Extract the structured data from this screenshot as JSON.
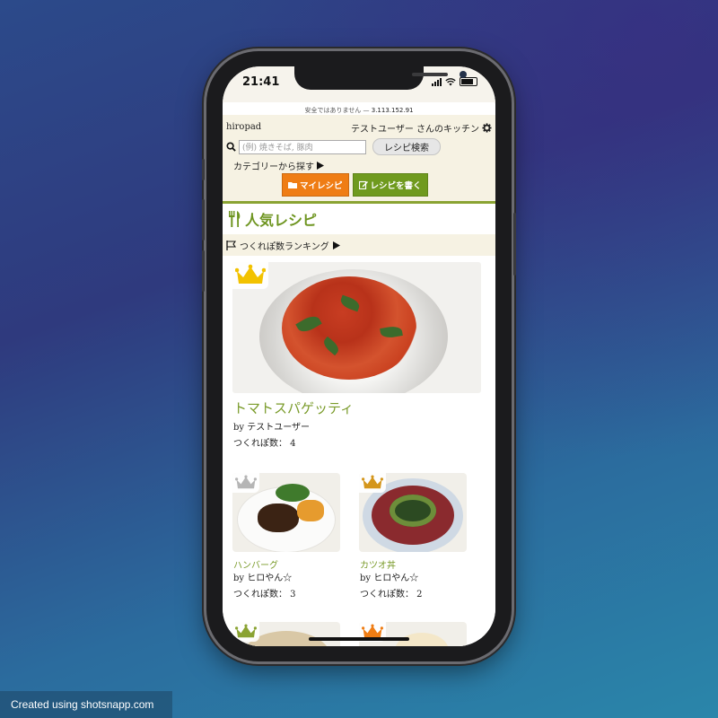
{
  "status_bar": {
    "time": "21:41"
  },
  "browser": {
    "security_note": "安全ではありません",
    "url": "3.113.152.91"
  },
  "header": {
    "site_name": "hiropad",
    "user_kitchen": "テストユーザー さんのキッチン",
    "search": {
      "placeholder": "(例) 焼きそば, 豚肉",
      "button": "レシピ検索"
    },
    "category_link": "カテゴリーから探す",
    "my_recipe_button": "マイレシピ",
    "write_recipe_button": "レシピを書く"
  },
  "main": {
    "section_title": "人気レシピ",
    "ranking_link": "つくれぽ数ランキング",
    "top_recipe": {
      "title": "トマトスパゲッティ",
      "author": "by テストユーザー",
      "tsukurepo": "つくれぽ数： 4"
    },
    "recipes": [
      {
        "title": "ハンバーグ",
        "author": "by ヒロやん☆",
        "tsukurepo": "つくれぽ数： 3"
      },
      {
        "title": "カツオ丼",
        "author": "by ヒロやん☆",
        "tsukurepo": "つくれぽ数： 2"
      }
    ]
  },
  "footer_credit": "Created using shotsnapp.com",
  "colors": {
    "accent_green": "#7a9b2a",
    "orange": "#ef7d14",
    "header_bg": "#f6f2e3",
    "crown_gold": "#f2c200",
    "crown_silver": "#b5b5b5",
    "crown_bronze": "#d4961c"
  }
}
